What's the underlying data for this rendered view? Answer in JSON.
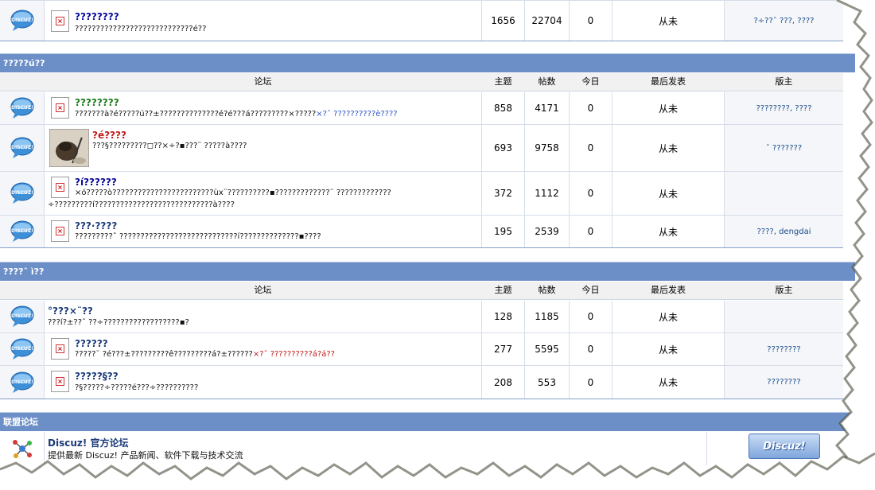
{
  "top_row": {
    "title": "????????",
    "desc": "????????????????????????????é??",
    "topics": "1656",
    "posts": "22704",
    "today": "0",
    "last": "从未",
    "mods": "?÷??ˆ ???, ????"
  },
  "category1": {
    "title": "?????ú??",
    "headers": {
      "forum": "论坛",
      "topics": "主题",
      "posts": "帖数",
      "today": "今日",
      "last": "最后发表",
      "mods": "版主"
    },
    "rows": [
      {
        "title": "????????",
        "desc_a": "???????à?é?????ú??±??????????????é?é???á?????????×?????",
        "desc_b": "×?ˆ ??????????è????",
        "topics": "858",
        "posts": "4171",
        "today": "0",
        "last": "从未",
        "mods": "????????, ????"
      },
      {
        "title": "?é????",
        "desc_a": "???§?????????◻??×÷?▪???¨ ?????à????",
        "topics": "693",
        "posts": "9758",
        "today": "0",
        "last": "从未",
        "mods": "ˆ ???????"
      },
      {
        "title": "?í??????",
        "desc_a": "×ó?????ò????????????????????????ùx¨??????????▪?????????????¨ ?????????????",
        "desc_b": "÷?????????í????????????????????????????à????",
        "topics": "372",
        "posts": "1112",
        "today": "0",
        "last": "从未",
        "mods": ""
      },
      {
        "title": "???·????",
        "desc_a": "?????????ˆ ????????????????????????????í??????????????▪????",
        "topics": "195",
        "posts": "2539",
        "today": "0",
        "last": "从未",
        "mods": "????, dengdai"
      }
    ]
  },
  "category2": {
    "title": "????ˆ ì??",
    "headers": {
      "forum": "论坛",
      "topics": "主题",
      "posts": "帖数",
      "today": "今日",
      "last": "最后发表",
      "mods": "版主"
    },
    "rows": [
      {
        "title": "°???×¨??",
        "desc_a": "???í?±??ˆ ??÷??????????????????▪?",
        "topics": "128",
        "posts": "1185",
        "today": "0",
        "last": "从未",
        "mods": ""
      },
      {
        "title": "??????",
        "desc_a": "?????¨ ?é???±?????????ê?????????á?±??????",
        "desc_b": "×?ˆ ??????????á?á??",
        "topics": "277",
        "posts": "5595",
        "today": "0",
        "last": "从未",
        "mods": "????????"
      },
      {
        "title": "?????§??",
        "desc_a": "?§?????÷?????é???÷??????????",
        "topics": "208",
        "posts": "553",
        "today": "0",
        "last": "从未",
        "mods": "????????"
      }
    ]
  },
  "category3": {
    "title": "联盟论坛",
    "rows": [
      {
        "title": "Discuz! 官方论坛",
        "desc_a": "提供最新 Discuz! 产品新闻、软件下载与技术交流",
        "logo": "Discuz!"
      }
    ]
  },
  "icons": {
    "forum_icon": "discuz-bubble-icon"
  }
}
